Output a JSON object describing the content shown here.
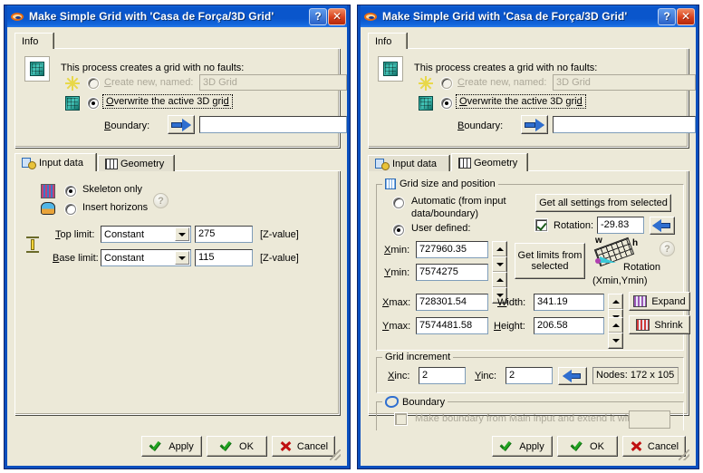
{
  "window": {
    "title": "Make Simple Grid with 'Casa de Força/3D Grid'",
    "icon": "torus-icon",
    "help_button": "?",
    "close_button": "✕"
  },
  "info_tab": {
    "label": "Info"
  },
  "info": {
    "process_icon": "grid-cube-icon",
    "description": "This process creates a grid with no faults:",
    "create_new": {
      "icon": "star-icon",
      "label": "Create new, named:",
      "selected": false,
      "value": "3D Grid",
      "disabled": true
    },
    "overwrite": {
      "icon": "grid-cube-icon",
      "label": "Overwrite the active 3D grid",
      "selected": true
    },
    "boundary": {
      "label": "Boundary:",
      "arrow_icon": "blue-right-arrow-icon",
      "value": ""
    }
  },
  "subtabs": {
    "input_data": {
      "label": "Input data",
      "icon": "input-data-icon"
    },
    "geometry": {
      "label": "Geometry",
      "icon": "grid-table-icon"
    }
  },
  "left_panel": {
    "active_subtab": "Input data",
    "skeleton_only": {
      "icon": "grid-cells-icon",
      "label": "Skeleton only",
      "selected": true
    },
    "insert_horizons": {
      "icon": "horizons-icon",
      "label": "Insert horizons",
      "selected": false
    },
    "help_icon": "question-mark-icon",
    "z_icon": "vertical-arrows-icon",
    "top_limit": {
      "label": "Top limit:",
      "mode": "Constant",
      "value": "275",
      "unit": "[Z-value]"
    },
    "base_limit": {
      "label": "Base limit:",
      "mode": "Constant",
      "value": "115",
      "unit": "[Z-value]"
    }
  },
  "right_panel": {
    "active_subtab": "Geometry",
    "grid_size_group": {
      "icon": "grid-blue-icon",
      "caption": "Grid size and position",
      "automatic": {
        "label_line1": "Automatic (from input",
        "label_line2": "data/boundary)",
        "selected": false
      },
      "user_defined": {
        "label": "User defined:",
        "selected": true
      },
      "get_all_settings_button": "Get all settings from selected",
      "rotation": {
        "checked": true,
        "label": "Rotation:",
        "value": "-29.83",
        "arrow_icon": "blue-left-arrow-icon"
      },
      "xmin": {
        "label": "Xmin:",
        "value": "727960.35"
      },
      "ymin": {
        "label": "Ymin:",
        "value": "7574275"
      },
      "xmax": {
        "label": "Xmax:",
        "value": "728301.54"
      },
      "ymax": {
        "label": "Ymax:",
        "value": "7574481.58"
      },
      "width": {
        "label": "Width:",
        "value": "341.19"
      },
      "height": {
        "label": "Height:",
        "value": "206.58"
      },
      "get_limits_button_line1": "Get limits from",
      "get_limits_button_line2": "selected",
      "rotation_diagram": {
        "icon": "rotation-diagram-icon",
        "w_label": "w",
        "h_label": "h",
        "rotation_label": "Rotation",
        "origin_label": "(Xmin,Ymin)"
      },
      "diagram_help_icon": "question-mark-icon",
      "expand_button": {
        "label": "Expand",
        "icon": "expand-grid-icon"
      },
      "shrink_button": {
        "label": "Shrink",
        "icon": "shrink-grid-icon"
      }
    },
    "grid_increment_group": {
      "caption": "Grid increment",
      "xinc": {
        "label": "Xinc:",
        "value": "2"
      },
      "yinc": {
        "label": "Yinc:",
        "value": "2"
      },
      "arrow_icon": "blue-left-arrow-icon",
      "nodes": "Nodes: 172 x 105"
    },
    "boundary_group": {
      "icon": "boundary-loop-icon",
      "caption": "Boundary",
      "make_boundary": {
        "checked": false,
        "disabled": true,
        "label": "Make boundary from Main input and extend it with:",
        "value": ""
      }
    }
  },
  "buttons": {
    "apply": {
      "label": "Apply",
      "icon": "green-check-icon"
    },
    "ok": {
      "label": "OK",
      "icon": "green-check-icon"
    },
    "cancel": {
      "label": "Cancel",
      "icon": "red-x-icon"
    }
  },
  "colors": {
    "title_bar": "#0a56cc",
    "dialog_face": "#ece9d8",
    "frame_blue": "#0b4fbe",
    "field_white": "#ffffff",
    "disabled_text": "#aca899"
  }
}
